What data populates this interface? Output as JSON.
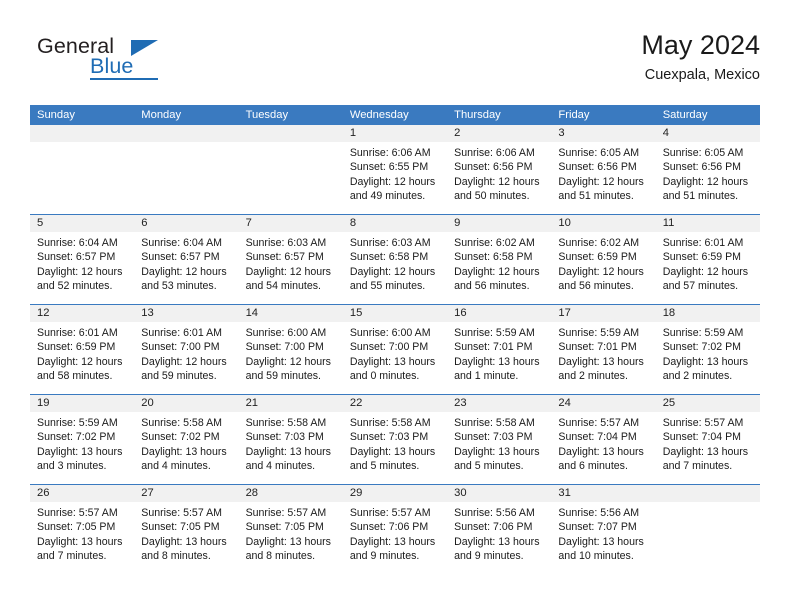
{
  "brand": {
    "name_top": "General",
    "name_bottom": "Blue",
    "accent_color": "#1f6cb4"
  },
  "header": {
    "title": "May 2024",
    "subtitle": "Cuexpala, Mexico"
  },
  "theme": {
    "header_blue": "#3a7ac0",
    "date_band_gray": "#f1f1f1",
    "text": "#1a1a1a"
  },
  "calendar": {
    "weekdays": [
      "Sunday",
      "Monday",
      "Tuesday",
      "Wednesday",
      "Thursday",
      "Friday",
      "Saturday"
    ],
    "weeks": [
      [
        {
          "day": "",
          "sunrise": "",
          "sunset": "",
          "daylight1": "",
          "daylight2": ""
        },
        {
          "day": "",
          "sunrise": "",
          "sunset": "",
          "daylight1": "",
          "daylight2": ""
        },
        {
          "day": "",
          "sunrise": "",
          "sunset": "",
          "daylight1": "",
          "daylight2": ""
        },
        {
          "day": "1",
          "sunrise": "Sunrise: 6:06 AM",
          "sunset": "Sunset: 6:55 PM",
          "daylight1": "Daylight: 12 hours",
          "daylight2": "and 49 minutes."
        },
        {
          "day": "2",
          "sunrise": "Sunrise: 6:06 AM",
          "sunset": "Sunset: 6:56 PM",
          "daylight1": "Daylight: 12 hours",
          "daylight2": "and 50 minutes."
        },
        {
          "day": "3",
          "sunrise": "Sunrise: 6:05 AM",
          "sunset": "Sunset: 6:56 PM",
          "daylight1": "Daylight: 12 hours",
          "daylight2": "and 51 minutes."
        },
        {
          "day": "4",
          "sunrise": "Sunrise: 6:05 AM",
          "sunset": "Sunset: 6:56 PM",
          "daylight1": "Daylight: 12 hours",
          "daylight2": "and 51 minutes."
        }
      ],
      [
        {
          "day": "5",
          "sunrise": "Sunrise: 6:04 AM",
          "sunset": "Sunset: 6:57 PM",
          "daylight1": "Daylight: 12 hours",
          "daylight2": "and 52 minutes."
        },
        {
          "day": "6",
          "sunrise": "Sunrise: 6:04 AM",
          "sunset": "Sunset: 6:57 PM",
          "daylight1": "Daylight: 12 hours",
          "daylight2": "and 53 minutes."
        },
        {
          "day": "7",
          "sunrise": "Sunrise: 6:03 AM",
          "sunset": "Sunset: 6:57 PM",
          "daylight1": "Daylight: 12 hours",
          "daylight2": "and 54 minutes."
        },
        {
          "day": "8",
          "sunrise": "Sunrise: 6:03 AM",
          "sunset": "Sunset: 6:58 PM",
          "daylight1": "Daylight: 12 hours",
          "daylight2": "and 55 minutes."
        },
        {
          "day": "9",
          "sunrise": "Sunrise: 6:02 AM",
          "sunset": "Sunset: 6:58 PM",
          "daylight1": "Daylight: 12 hours",
          "daylight2": "and 56 minutes."
        },
        {
          "day": "10",
          "sunrise": "Sunrise: 6:02 AM",
          "sunset": "Sunset: 6:59 PM",
          "daylight1": "Daylight: 12 hours",
          "daylight2": "and 56 minutes."
        },
        {
          "day": "11",
          "sunrise": "Sunrise: 6:01 AM",
          "sunset": "Sunset: 6:59 PM",
          "daylight1": "Daylight: 12 hours",
          "daylight2": "and 57 minutes."
        }
      ],
      [
        {
          "day": "12",
          "sunrise": "Sunrise: 6:01 AM",
          "sunset": "Sunset: 6:59 PM",
          "daylight1": "Daylight: 12 hours",
          "daylight2": "and 58 minutes."
        },
        {
          "day": "13",
          "sunrise": "Sunrise: 6:01 AM",
          "sunset": "Sunset: 7:00 PM",
          "daylight1": "Daylight: 12 hours",
          "daylight2": "and 59 minutes."
        },
        {
          "day": "14",
          "sunrise": "Sunrise: 6:00 AM",
          "sunset": "Sunset: 7:00 PM",
          "daylight1": "Daylight: 12 hours",
          "daylight2": "and 59 minutes."
        },
        {
          "day": "15",
          "sunrise": "Sunrise: 6:00 AM",
          "sunset": "Sunset: 7:00 PM",
          "daylight1": "Daylight: 13 hours",
          "daylight2": "and 0 minutes."
        },
        {
          "day": "16",
          "sunrise": "Sunrise: 5:59 AM",
          "sunset": "Sunset: 7:01 PM",
          "daylight1": "Daylight: 13 hours",
          "daylight2": "and 1 minute."
        },
        {
          "day": "17",
          "sunrise": "Sunrise: 5:59 AM",
          "sunset": "Sunset: 7:01 PM",
          "daylight1": "Daylight: 13 hours",
          "daylight2": "and 2 minutes."
        },
        {
          "day": "18",
          "sunrise": "Sunrise: 5:59 AM",
          "sunset": "Sunset: 7:02 PM",
          "daylight1": "Daylight: 13 hours",
          "daylight2": "and 2 minutes."
        }
      ],
      [
        {
          "day": "19",
          "sunrise": "Sunrise: 5:59 AM",
          "sunset": "Sunset: 7:02 PM",
          "daylight1": "Daylight: 13 hours",
          "daylight2": "and 3 minutes."
        },
        {
          "day": "20",
          "sunrise": "Sunrise: 5:58 AM",
          "sunset": "Sunset: 7:02 PM",
          "daylight1": "Daylight: 13 hours",
          "daylight2": "and 4 minutes."
        },
        {
          "day": "21",
          "sunrise": "Sunrise: 5:58 AM",
          "sunset": "Sunset: 7:03 PM",
          "daylight1": "Daylight: 13 hours",
          "daylight2": "and 4 minutes."
        },
        {
          "day": "22",
          "sunrise": "Sunrise: 5:58 AM",
          "sunset": "Sunset: 7:03 PM",
          "daylight1": "Daylight: 13 hours",
          "daylight2": "and 5 minutes."
        },
        {
          "day": "23",
          "sunrise": "Sunrise: 5:58 AM",
          "sunset": "Sunset: 7:03 PM",
          "daylight1": "Daylight: 13 hours",
          "daylight2": "and 5 minutes."
        },
        {
          "day": "24",
          "sunrise": "Sunrise: 5:57 AM",
          "sunset": "Sunset: 7:04 PM",
          "daylight1": "Daylight: 13 hours",
          "daylight2": "and 6 minutes."
        },
        {
          "day": "25",
          "sunrise": "Sunrise: 5:57 AM",
          "sunset": "Sunset: 7:04 PM",
          "daylight1": "Daylight: 13 hours",
          "daylight2": "and 7 minutes."
        }
      ],
      [
        {
          "day": "26",
          "sunrise": "Sunrise: 5:57 AM",
          "sunset": "Sunset: 7:05 PM",
          "daylight1": "Daylight: 13 hours",
          "daylight2": "and 7 minutes."
        },
        {
          "day": "27",
          "sunrise": "Sunrise: 5:57 AM",
          "sunset": "Sunset: 7:05 PM",
          "daylight1": "Daylight: 13 hours",
          "daylight2": "and 8 minutes."
        },
        {
          "day": "28",
          "sunrise": "Sunrise: 5:57 AM",
          "sunset": "Sunset: 7:05 PM",
          "daylight1": "Daylight: 13 hours",
          "daylight2": "and 8 minutes."
        },
        {
          "day": "29",
          "sunrise": "Sunrise: 5:57 AM",
          "sunset": "Sunset: 7:06 PM",
          "daylight1": "Daylight: 13 hours",
          "daylight2": "and 9 minutes."
        },
        {
          "day": "30",
          "sunrise": "Sunrise: 5:56 AM",
          "sunset": "Sunset: 7:06 PM",
          "daylight1": "Daylight: 13 hours",
          "daylight2": "and 9 minutes."
        },
        {
          "day": "31",
          "sunrise": "Sunrise: 5:56 AM",
          "sunset": "Sunset: 7:07 PM",
          "daylight1": "Daylight: 13 hours",
          "daylight2": "and 10 minutes."
        },
        {
          "day": "",
          "sunrise": "",
          "sunset": "",
          "daylight1": "",
          "daylight2": ""
        }
      ]
    ]
  }
}
